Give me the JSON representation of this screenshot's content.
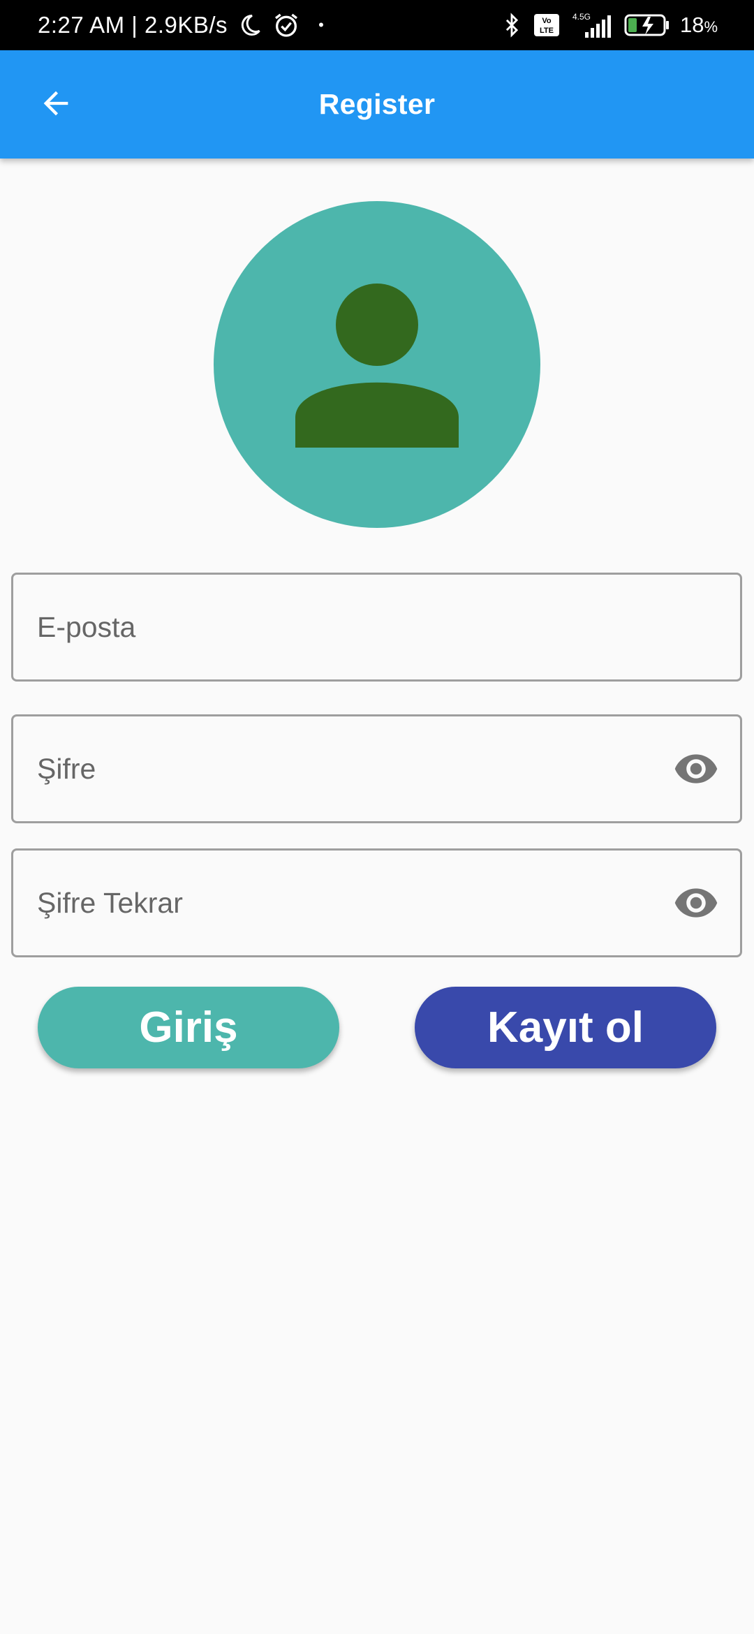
{
  "status_bar": {
    "time_speed": "2:27 AM | 2.9KB/s",
    "dot": "•",
    "network": "4.5G",
    "volte": "Vo LTE",
    "battery": "18",
    "battery_unit": "%"
  },
  "app_bar": {
    "title": "Register"
  },
  "form": {
    "email_placeholder": "E-posta",
    "password_placeholder": "Şifre",
    "password_repeat_placeholder": "Şifre Tekrar"
  },
  "buttons": {
    "login_label": "Giriş",
    "register_label": "Kayıt ol"
  },
  "colors": {
    "app_bar": "#2196f3",
    "avatar_bg": "#4db6ac",
    "avatar_figure": "#33691e",
    "login_button": "#4db6ac",
    "register_button": "#3949ab"
  }
}
